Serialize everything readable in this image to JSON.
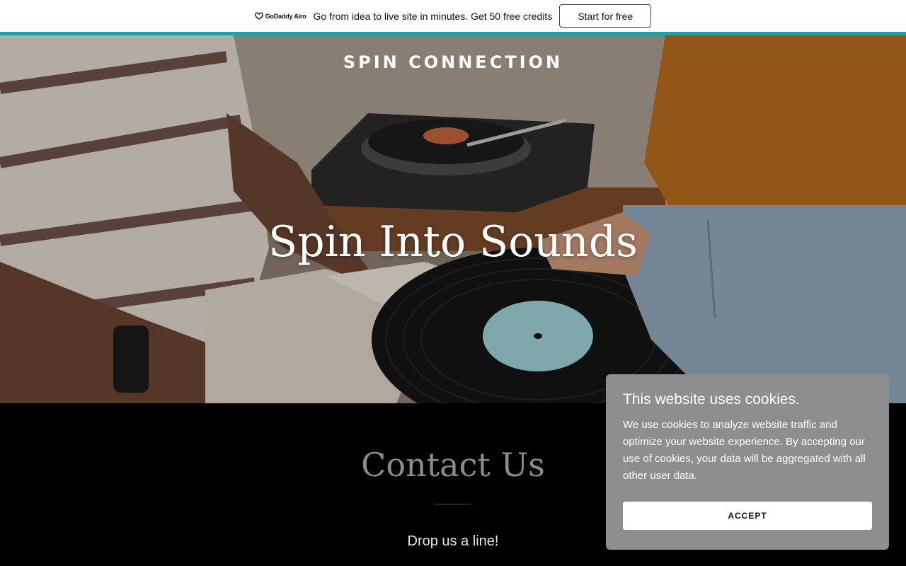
{
  "promo": {
    "logo_text": "GoDaddy Airo",
    "message": "Go from idea to live site in minutes. Get 50 free credits",
    "cta_label": "Start for free",
    "accent_color": "#1ba3a6"
  },
  "hero": {
    "site_title": "SPIN CONNECTION",
    "heading": "Spin Into Sounds"
  },
  "contact": {
    "title": "Contact Us",
    "subtitle": "Drop us a line!"
  },
  "cookie_banner": {
    "title": "This website uses cookies.",
    "body": "We use cookies to analyze website traffic and optimize your website experience. By accepting our use of cookies, your data will be aggregated with all other user data.",
    "accept_label": "ACCEPT"
  }
}
